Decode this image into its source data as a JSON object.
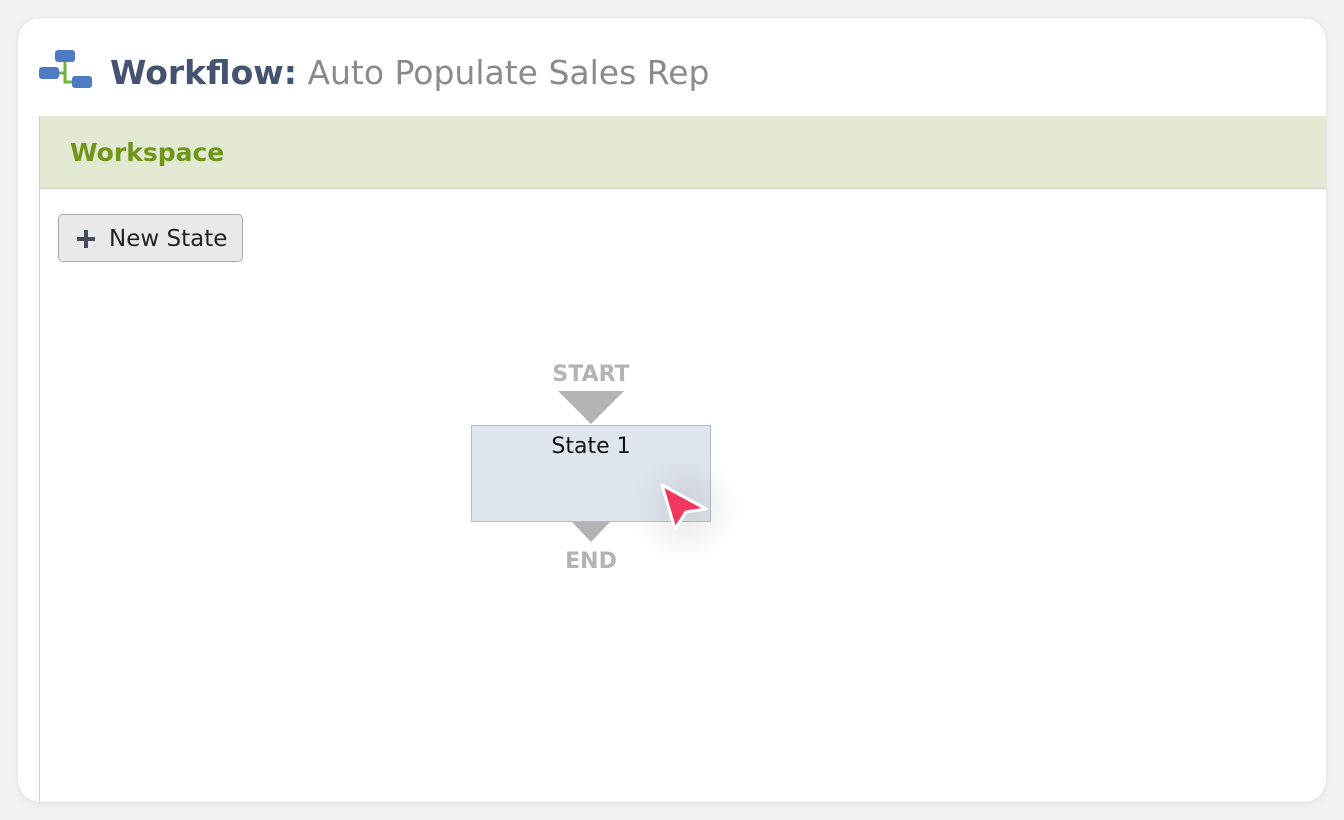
{
  "header": {
    "title_prefix": "Workflow:",
    "title_name": "Auto Populate Sales Rep",
    "icon": "workflow-tree-icon"
  },
  "workspace": {
    "header_title": "Workspace",
    "new_state_button": {
      "label": "New State",
      "icon": "plus-icon"
    },
    "diagram": {
      "start_label": "START",
      "end_label": "END",
      "states": [
        {
          "label": "State 1"
        }
      ]
    }
  },
  "cursor": {
    "icon": "mouse-pointer-icon",
    "color": "#f0385f"
  },
  "colors": {
    "title_prefix": "#44536f",
    "title_name": "#8a8a8a",
    "workspace_header_bg": "#e2e8d1",
    "workspace_header_text": "#6f9519",
    "state_box_bg": "#dfe5ee",
    "start_end_marker": "#b3b3b3"
  }
}
